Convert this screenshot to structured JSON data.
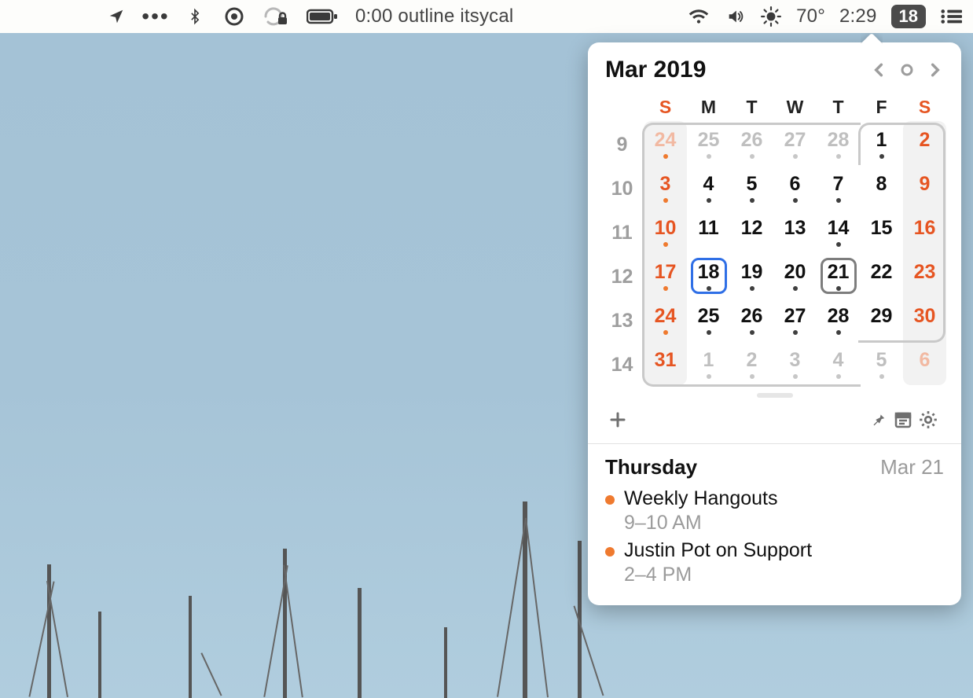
{
  "menubar": {
    "now_playing": "0:00 outline itsycal",
    "temperature": "70°",
    "clock": "2:29",
    "date_pill": "18"
  },
  "calendar": {
    "month_label": "Mar 2019",
    "dow": [
      "S",
      "M",
      "T",
      "W",
      "T",
      "F",
      "S"
    ],
    "weeks": [
      {
        "wn": "9",
        "days": [
          {
            "n": "24",
            "weekend": true,
            "outside": true,
            "dot": "orange"
          },
          {
            "n": "25",
            "outside": true,
            "dot": "out"
          },
          {
            "n": "26",
            "outside": true,
            "dot": "out"
          },
          {
            "n": "27",
            "outside": true,
            "dot": "out"
          },
          {
            "n": "28",
            "outside": true,
            "dot": "out"
          },
          {
            "n": "1",
            "dot": "black"
          },
          {
            "n": "2",
            "weekend": true,
            "dot": "none"
          }
        ]
      },
      {
        "wn": "10",
        "days": [
          {
            "n": "3",
            "weekend": true,
            "dot": "orange"
          },
          {
            "n": "4",
            "dot": "black"
          },
          {
            "n": "5",
            "dot": "black"
          },
          {
            "n": "6",
            "dot": "black"
          },
          {
            "n": "7",
            "dot": "black"
          },
          {
            "n": "8",
            "dot": "none"
          },
          {
            "n": "9",
            "weekend": true,
            "dot": "none"
          }
        ]
      },
      {
        "wn": "11",
        "days": [
          {
            "n": "10",
            "weekend": true,
            "dot": "orange"
          },
          {
            "n": "11",
            "dot": "none"
          },
          {
            "n": "12",
            "dot": "none"
          },
          {
            "n": "13",
            "dot": "none"
          },
          {
            "n": "14",
            "dot": "black"
          },
          {
            "n": "15",
            "dot": "none"
          },
          {
            "n": "16",
            "weekend": true,
            "dot": "none"
          }
        ]
      },
      {
        "wn": "12",
        "days": [
          {
            "n": "17",
            "weekend": true,
            "dot": "orange"
          },
          {
            "n": "18",
            "dot": "black",
            "today": true
          },
          {
            "n": "19",
            "dot": "black"
          },
          {
            "n": "20",
            "dot": "black"
          },
          {
            "n": "21",
            "dot": "black",
            "selected": true
          },
          {
            "n": "22",
            "dot": "none"
          },
          {
            "n": "23",
            "weekend": true,
            "dot": "none"
          }
        ]
      },
      {
        "wn": "13",
        "days": [
          {
            "n": "24",
            "weekend": true,
            "dot": "orange"
          },
          {
            "n": "25",
            "dot": "black"
          },
          {
            "n": "26",
            "dot": "black"
          },
          {
            "n": "27",
            "dot": "black"
          },
          {
            "n": "28",
            "dot": "black"
          },
          {
            "n": "29",
            "dot": "none"
          },
          {
            "n": "30",
            "weekend": true,
            "dot": "none"
          }
        ]
      },
      {
        "wn": "14",
        "days": [
          {
            "n": "31",
            "weekend": true,
            "dot": "none"
          },
          {
            "n": "1",
            "outside": true,
            "dot": "out"
          },
          {
            "n": "2",
            "outside": true,
            "dot": "out"
          },
          {
            "n": "3",
            "outside": true,
            "dot": "out"
          },
          {
            "n": "4",
            "outside": true,
            "dot": "out"
          },
          {
            "n": "5",
            "outside": true,
            "dot": "out"
          },
          {
            "n": "6",
            "weekend": true,
            "outside": true,
            "dot": "none"
          }
        ]
      }
    ]
  },
  "agenda": {
    "day_name": "Thursday",
    "day_date": "Mar 21",
    "events": [
      {
        "title": "Weekly Hangouts",
        "time": "9–10 AM",
        "color": "#ef7a2f"
      },
      {
        "title": "Justin Pot on Support",
        "time": "2–4 PM",
        "color": "#ef7a2f"
      }
    ]
  }
}
